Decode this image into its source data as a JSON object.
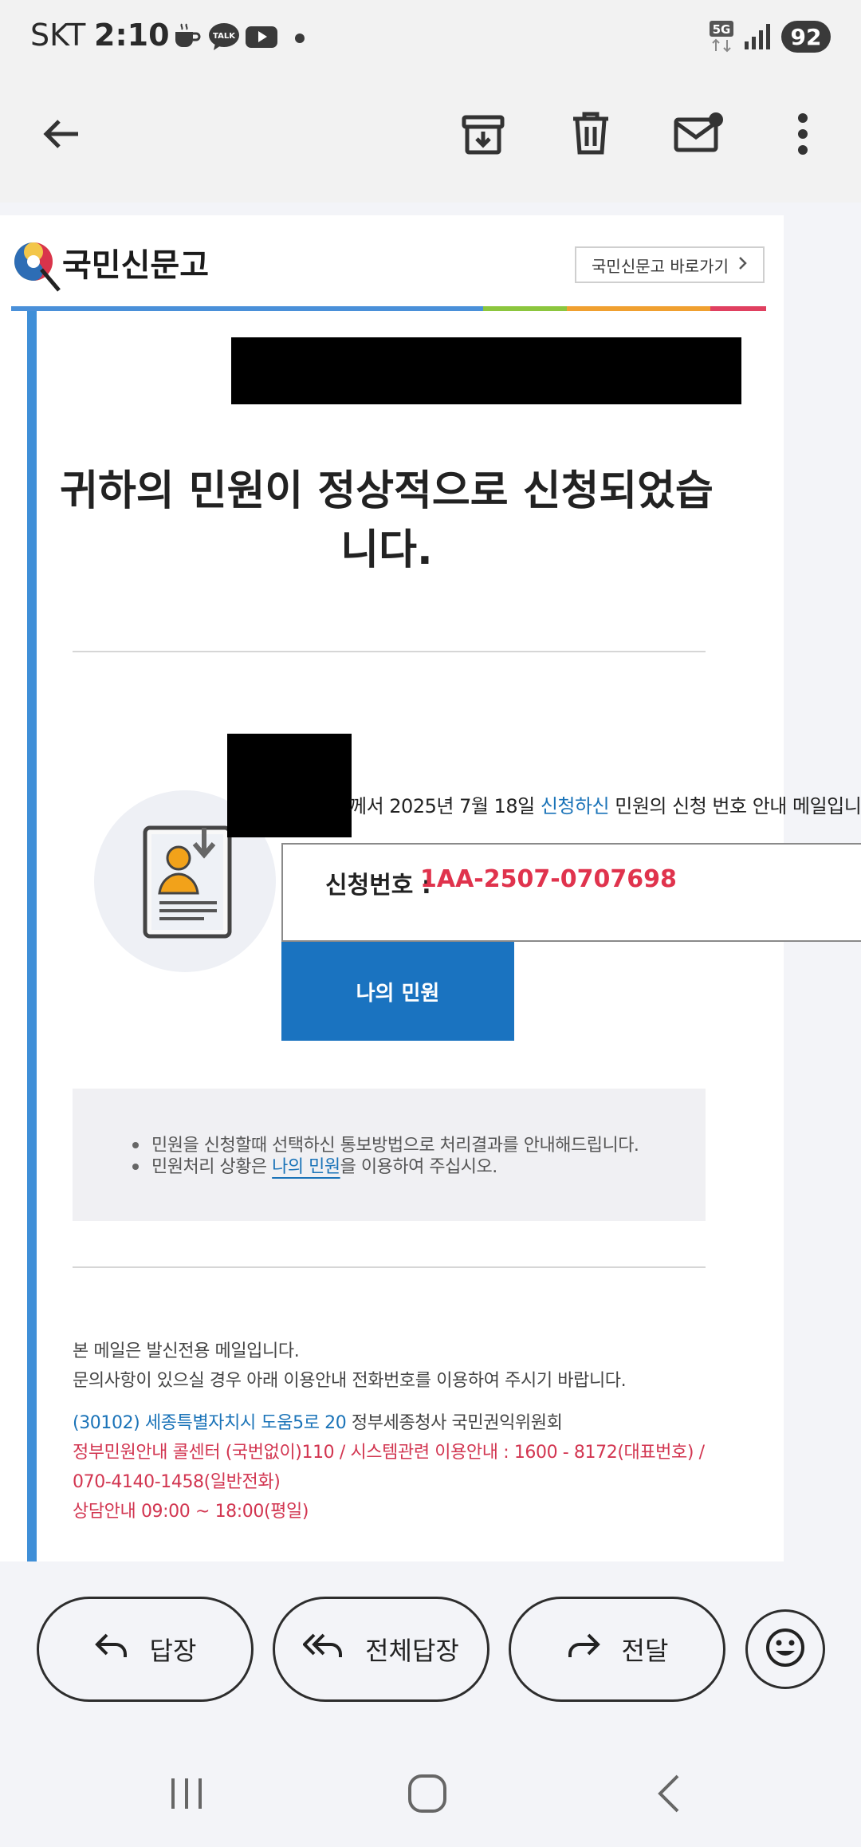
{
  "status_bar": {
    "carrier": "SKT",
    "time": "2:10",
    "network": "5G",
    "battery": "92",
    "icons": [
      "coffee-icon",
      "kakaotalk-icon",
      "youtube-icon",
      "dot-icon",
      "network-5g-icon",
      "signal-icon"
    ],
    "talk_label": "TALK"
  },
  "toolbar": {
    "icons": [
      "back-arrow-icon",
      "archive-icon",
      "delete-icon",
      "mark-unread-icon",
      "more-vert-icon"
    ]
  },
  "email": {
    "logo_text": "국민신문고",
    "shortcut_label": "국민신문고 바로가기",
    "stripe_colors": [
      "#4a90d9",
      "#8cc63e",
      "#f0a030",
      "#e04060"
    ],
    "headline": "귀하의 민원이 정상적으로 신청되었습니다.",
    "info_prefix": "께서 2025년 7월 18일 ",
    "info_link": "신청하신",
    "info_suffix": " 민원의 신청 번호 안내 메일입니다.",
    "request_label": "신청번호 :",
    "request_number": "1AA-2507-0707698",
    "my_complaint_button": "나의 민원",
    "notice_line_1": "민원을 신청할때 선택하신 통보방법으로 처리결과를 안내해드립니다.",
    "notice_line_2_prefix": "민원처리 상황은 ",
    "notice_line_2_link": "나의 민원",
    "notice_line_2_suffix": "을 이용하여 주십시오.",
    "footer_line_1": "본 메일은 발신전용 메일입니다.",
    "footer_line_2": "문의사항이 있으실 경우 아래 이용안내 전화번호를 이용하여 주시기 바랍니다.",
    "address_paren_open": "(",
    "address_link": "30102) 세종특별자치시 도움5로 20",
    "address_rest": " 정부세종청사 국민권익위원회",
    "contact_line_1": "정부민원안내 콜센터 (국번없이)110 / 시스템관련 이용안내 : 1600 - 8172(대표번호) /",
    "contact_line_2": "070-4140-1458(일반전화)",
    "contact_line_3": "상담안내 09:00 ~ 18:00(평일)",
    "accent_red": "#e0334d",
    "accent_blue": "#1a73c0"
  },
  "reply_bar": {
    "reply": "답장",
    "reply_all": "전체답장",
    "forward": "전달",
    "emoji_icon": "emoji-icon"
  },
  "nav_bar": {
    "icons": [
      "recent-apps-icon",
      "home-icon",
      "back-nav-icon"
    ]
  }
}
